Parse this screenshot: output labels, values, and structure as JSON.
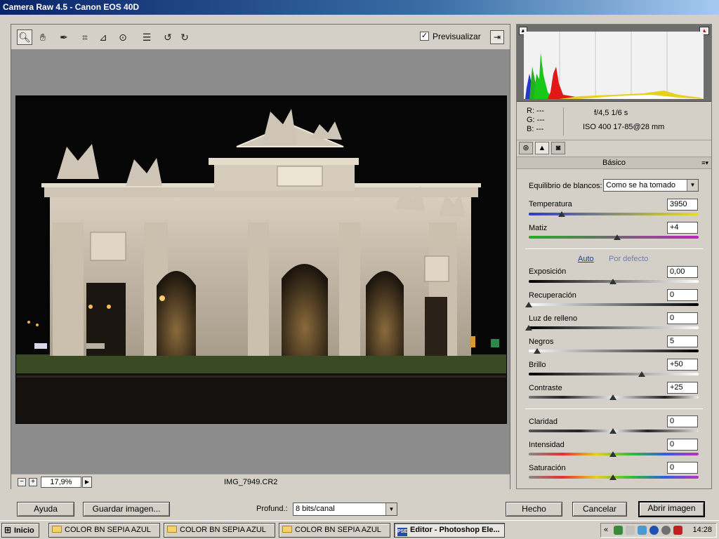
{
  "window": {
    "title": "Camera Raw 4.5 -  Canon EOS 40D"
  },
  "toolbar": {
    "tools": [
      "zoom-icon",
      "hand-icon",
      "eyedropper-icon",
      "crop-icon",
      "straighten-icon",
      "red-eye-icon",
      "preferences-icon",
      "rotate-left-icon",
      "rotate-right-icon"
    ],
    "preview_label": "Previsualizar",
    "preview_checked": "✓",
    "fullscreen_glyph": "⇥"
  },
  "status": {
    "zoom_out": "−",
    "zoom_in": "+",
    "zoom_value": "17,9%",
    "zoom_menu": "▶",
    "filename": "IMG_7949.CR2"
  },
  "info": {
    "r_label": "R:  ---",
    "g_label": "G:  ---",
    "b_label": "B:  ---",
    "aperture_shutter": "f/4,5   1/6 s",
    "iso_lens": "ISO 400   17-85@28 mm"
  },
  "panel": {
    "section_title": "Básico",
    "section_menu": "≡▾",
    "white_balance": {
      "label": "Equilibrio de blancos:",
      "value": "Como se ha tomado"
    },
    "auto_label": "Auto",
    "default_label": "Por defecto",
    "sliders": [
      {
        "label": "Temperatura",
        "value": "3950"
      },
      {
        "label": "Matiz",
        "value": "+4"
      },
      {
        "label": "Exposición",
        "value": "0,00"
      },
      {
        "label": "Recuperación",
        "value": "0"
      },
      {
        "label": "Luz de relleno",
        "value": "0"
      },
      {
        "label": "Negros",
        "value": "5"
      },
      {
        "label": "Brillo",
        "value": "+50"
      },
      {
        "label": "Contraste",
        "value": "+25"
      },
      {
        "label": "Claridad",
        "value": "0"
      },
      {
        "label": "Intensidad",
        "value": "0"
      },
      {
        "label": "Saturación",
        "value": "0"
      }
    ]
  },
  "bottom": {
    "help": "Ayuda",
    "save": "Guardar imagen...",
    "depth_label": "Profund.:",
    "depth_value": "8 bits/canal",
    "done": "Hecho",
    "cancel": "Cancelar",
    "open": "Abrir imagen"
  },
  "taskbar": {
    "start": "Inicio",
    "tasks": [
      "COLOR BN SEPIA AZUL",
      "COLOR BN SEPIA AZUL",
      "COLOR BN SEPIA AZUL",
      "Editor - Photoshop Ele..."
    ],
    "active_app_glyph": "PSE",
    "tray_chevron": "«",
    "time": "14:28"
  }
}
